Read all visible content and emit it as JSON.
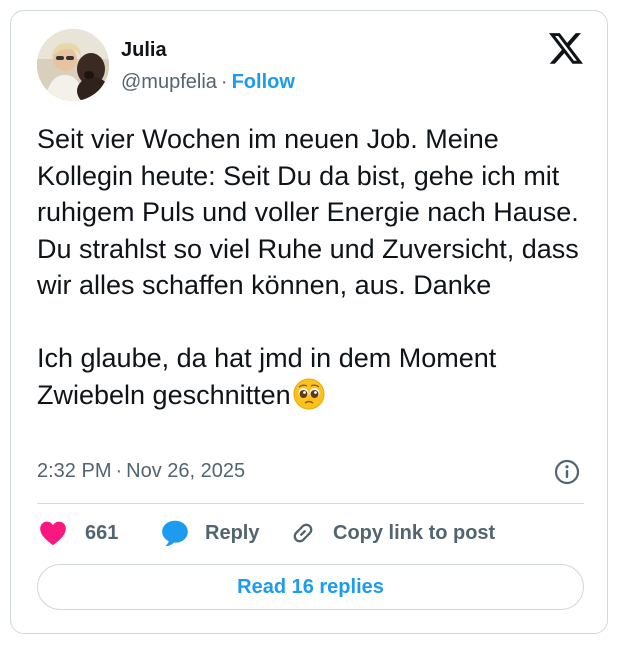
{
  "author": {
    "name": "Julia",
    "handle": "@mupfelia",
    "separator": "·",
    "follow_label": "Follow"
  },
  "tweet": {
    "text": "Seit vier Wochen im neuen Job. Meine Kollegin heute: Seit Du da bist, gehe ich mit ruhigem Puls und voller Energie nach Hause. Du strahlst so viel Ruhe und Zuversicht, dass wir alles schaffen können, aus. Danke\n\nIch glaube, da hat jmd in dem Moment Zwiebeln geschnitten",
    "emoji_icon": "pleading-face-emoji",
    "time": "2:32 PM",
    "separator": "·",
    "date": "Nov 26, 2025"
  },
  "actions": {
    "like_count": "661",
    "reply_label": "Reply",
    "copy_link_label": "Copy link to post"
  },
  "read_replies_label": "Read 16 replies",
  "icons": {
    "brand": "x-logo-icon",
    "info": "info-icon",
    "like": "heart-icon",
    "reply": "speech-bubble-icon",
    "copy": "link-icon"
  },
  "colors": {
    "accent": "#1d9bf0",
    "like": "#f91880",
    "text": "#0f1419",
    "secondary": "#536471",
    "border": "#cfd9de"
  }
}
